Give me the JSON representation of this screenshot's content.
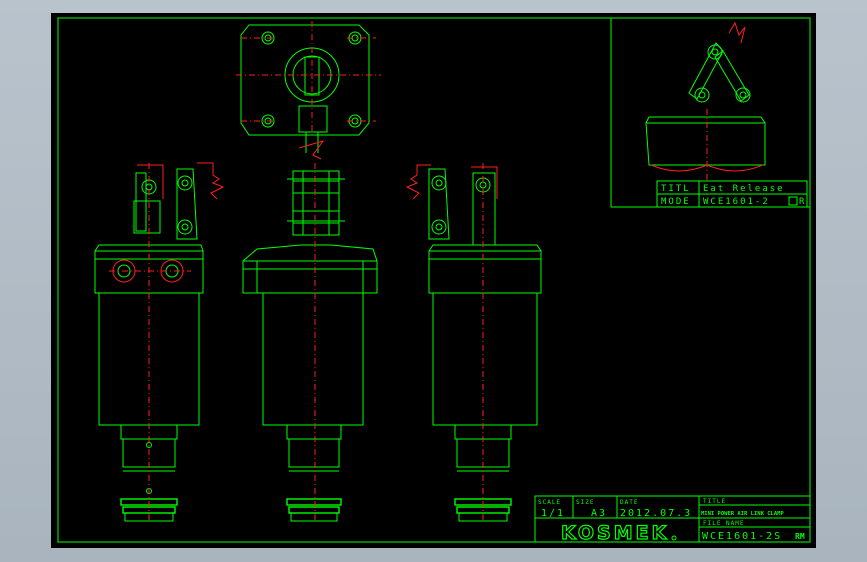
{
  "drawing": {
    "inset": {
      "title_label": "TITL",
      "title_value": "Eat Release",
      "mode_label": "MODE",
      "mode_value": "WCE1601-2",
      "mode_suffix": "R"
    },
    "titleblock": {
      "scale_label": "SCALE",
      "scale_value": "1/1",
      "size_label": "SIZE",
      "size_value": "A3",
      "date_label": "DATE",
      "date_value": "2012.07.3",
      "title_label": "TITLE",
      "title_value": "MINI POWER AIR LINK CLAMP",
      "filename_label": "FILE NAME",
      "filename_value": "WCE1601-2S",
      "filename_suffix": "RM",
      "logo": "KOSMEK"
    },
    "colors": {
      "line": "#00ff00",
      "center": "#ff2020",
      "background": "#000000"
    }
  }
}
